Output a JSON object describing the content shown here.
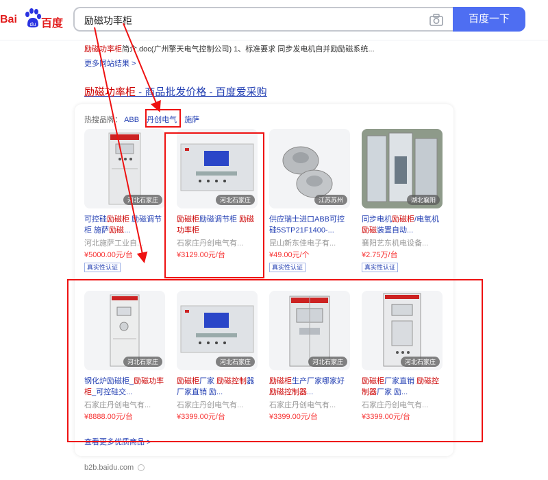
{
  "logo": {
    "left": "Bai",
    "right": "百度"
  },
  "search": {
    "query": "励磁功率柜",
    "button": "百度一下"
  },
  "snippet": {
    "highlight": "励磁功率柜",
    "text": "简介.doc(广州擎天电气控制公司) 1、标准要求 同步发电机自并励励磁系统..."
  },
  "more_from_site": "更多同站结果 >",
  "result": {
    "title_highlight": "励磁功率柜",
    "title_rest": " - 商品批发价格 - 百度爱采购"
  },
  "hot_brands": {
    "label": "热搜品牌：",
    "items": [
      "ABB",
      "丹创电气",
      "施萨"
    ]
  },
  "products": [
    {
      "title_parts": [
        [
          "可控硅",
          false
        ],
        [
          "励磁柜",
          true
        ],
        [
          " 励磁调节柜 施萨",
          false
        ],
        [
          "励磁",
          true
        ],
        [
          "...",
          false
        ]
      ],
      "shop": "河北施萨工业自...",
      "price": "¥5000.00元/台",
      "location": "河北石家庄",
      "badge": "真实性认证"
    },
    {
      "title_parts": [
        [
          "励磁柜",
          true
        ],
        [
          "励磁调节柜 ",
          false
        ],
        [
          "励磁功率柜",
          true
        ]
      ],
      "shop": "石家庄丹创电气有...",
      "price": "¥3129.00元/台",
      "location": "河北石家庄",
      "badge": ""
    },
    {
      "title_parts": [
        [
          "供应瑞士进口ABB可控硅5STP21F1400-...",
          false
        ]
      ],
      "shop": "昆山新东佳电子有...",
      "price": "¥49.00元/个",
      "location": "江苏苏州",
      "badge": "真实性认证"
    },
    {
      "title_parts": [
        [
          "同步电机",
          false
        ],
        [
          "励磁柜",
          true
        ],
        [
          "/电氧机",
          false
        ],
        [
          "励磁",
          true
        ],
        [
          "装置自动...",
          false
        ]
      ],
      "shop": "襄阳艺东机电设备...",
      "price": "¥2.75万/台",
      "location": "湖北襄阳",
      "badge": "真实性认证"
    },
    {
      "title_parts": [
        [
          "钢化炉励磁柜_",
          false
        ],
        [
          "励磁功率柜",
          true
        ],
        [
          "_可控硅交...",
          false
        ]
      ],
      "shop": "石家庄丹创电气有...",
      "price": "¥8888.00元/台",
      "location": "河北石家庄",
      "badge": ""
    },
    {
      "title_parts": [
        [
          "励磁柜",
          true
        ],
        [
          "厂家 ",
          false
        ],
        [
          "励磁控制",
          true
        ],
        [
          "器厂家直销 励...",
          false
        ]
      ],
      "shop": "石家庄丹创电气有...",
      "price": "¥3399.00元/台",
      "location": "河北石家庄",
      "badge": ""
    },
    {
      "title_parts": [
        [
          "励磁柜",
          true
        ],
        [
          "生产厂家哪家好 ",
          false
        ],
        [
          "励磁控制器",
          true
        ],
        [
          "...",
          false
        ]
      ],
      "shop": "石家庄丹创电气有...",
      "price": "¥3399.00元/台",
      "location": "河北石家庄",
      "badge": ""
    },
    {
      "title_parts": [
        [
          "励磁柜",
          true
        ],
        [
          "厂家直销 ",
          false
        ],
        [
          "励磁控制器",
          true
        ],
        [
          "厂家 励...",
          false
        ]
      ],
      "shop": "石家庄丹创电气有...",
      "price": "¥3399.00元/台",
      "location": "河北石家庄",
      "badge": ""
    }
  ],
  "more_products": "查看更多优质商品 >",
  "source": "b2b.baidu.com",
  "colors": {
    "accent": "#4e6ef2",
    "link": "#2440b3",
    "highlight": "#cc0000",
    "price": "#f73131",
    "annotation": "#ee1111"
  }
}
